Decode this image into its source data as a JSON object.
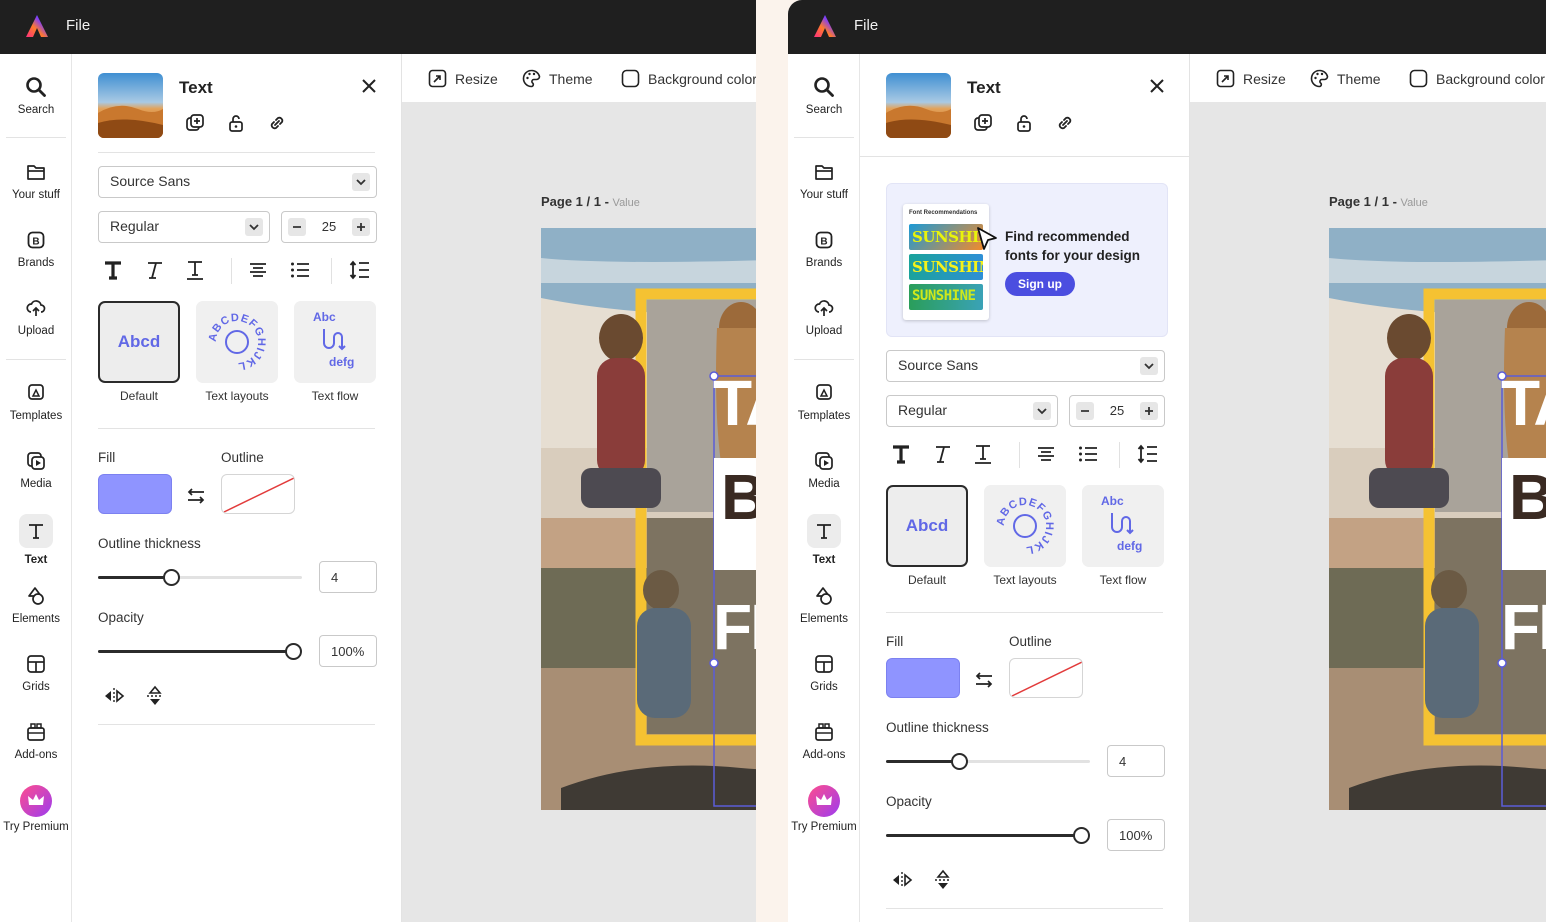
{
  "app": {
    "menu_file": "File"
  },
  "rail": {
    "items": [
      {
        "label": "Search"
      },
      {
        "label": "Your stuff"
      },
      {
        "label": "Brands"
      },
      {
        "label": "Upload"
      },
      {
        "label": "Templates"
      },
      {
        "label": "Media"
      },
      {
        "label": "Text"
      },
      {
        "label": "Elements"
      },
      {
        "label": "Grids"
      },
      {
        "label": "Add-ons"
      },
      {
        "label": "Try Premium"
      }
    ],
    "active": "Text"
  },
  "panel": {
    "title": "Text",
    "font_family": "Source Sans",
    "font_weight": "Regular",
    "font_size": "25",
    "text_cards": [
      {
        "label": "Default",
        "preview": "Abcd"
      },
      {
        "label": "Text layouts",
        "preview": "ABCDEFGHIJKL"
      },
      {
        "label": "Text flow",
        "preview_top": "Abc",
        "preview_bottom": "defg"
      }
    ],
    "fill_label": "Fill",
    "outline_label": "Outline",
    "fill_color": "#8f94ff",
    "outline_thickness_label": "Outline thickness",
    "outline_thickness_value": "4",
    "outline_thickness_level": 0.35,
    "opacity_label": "Opacity",
    "opacity_value": "100%",
    "opacity_level": 1.0
  },
  "promo": {
    "card_title": "Font Recommendations",
    "sample_word": "SUNSHINE",
    "headline": "Find recommended fonts for your design",
    "button": "Sign up"
  },
  "canvas": {
    "toolbar": {
      "resize": "Resize",
      "theme": "Theme",
      "background_color": "Background color"
    },
    "page_label": "Page 1 / 1 -",
    "page_value": "Value",
    "design_text": [
      "TA",
      "B",
      "FI"
    ]
  },
  "colors": {
    "accent": "#4b4ee0",
    "frame": "#f5c232",
    "topbar": "#1f1f1f"
  }
}
